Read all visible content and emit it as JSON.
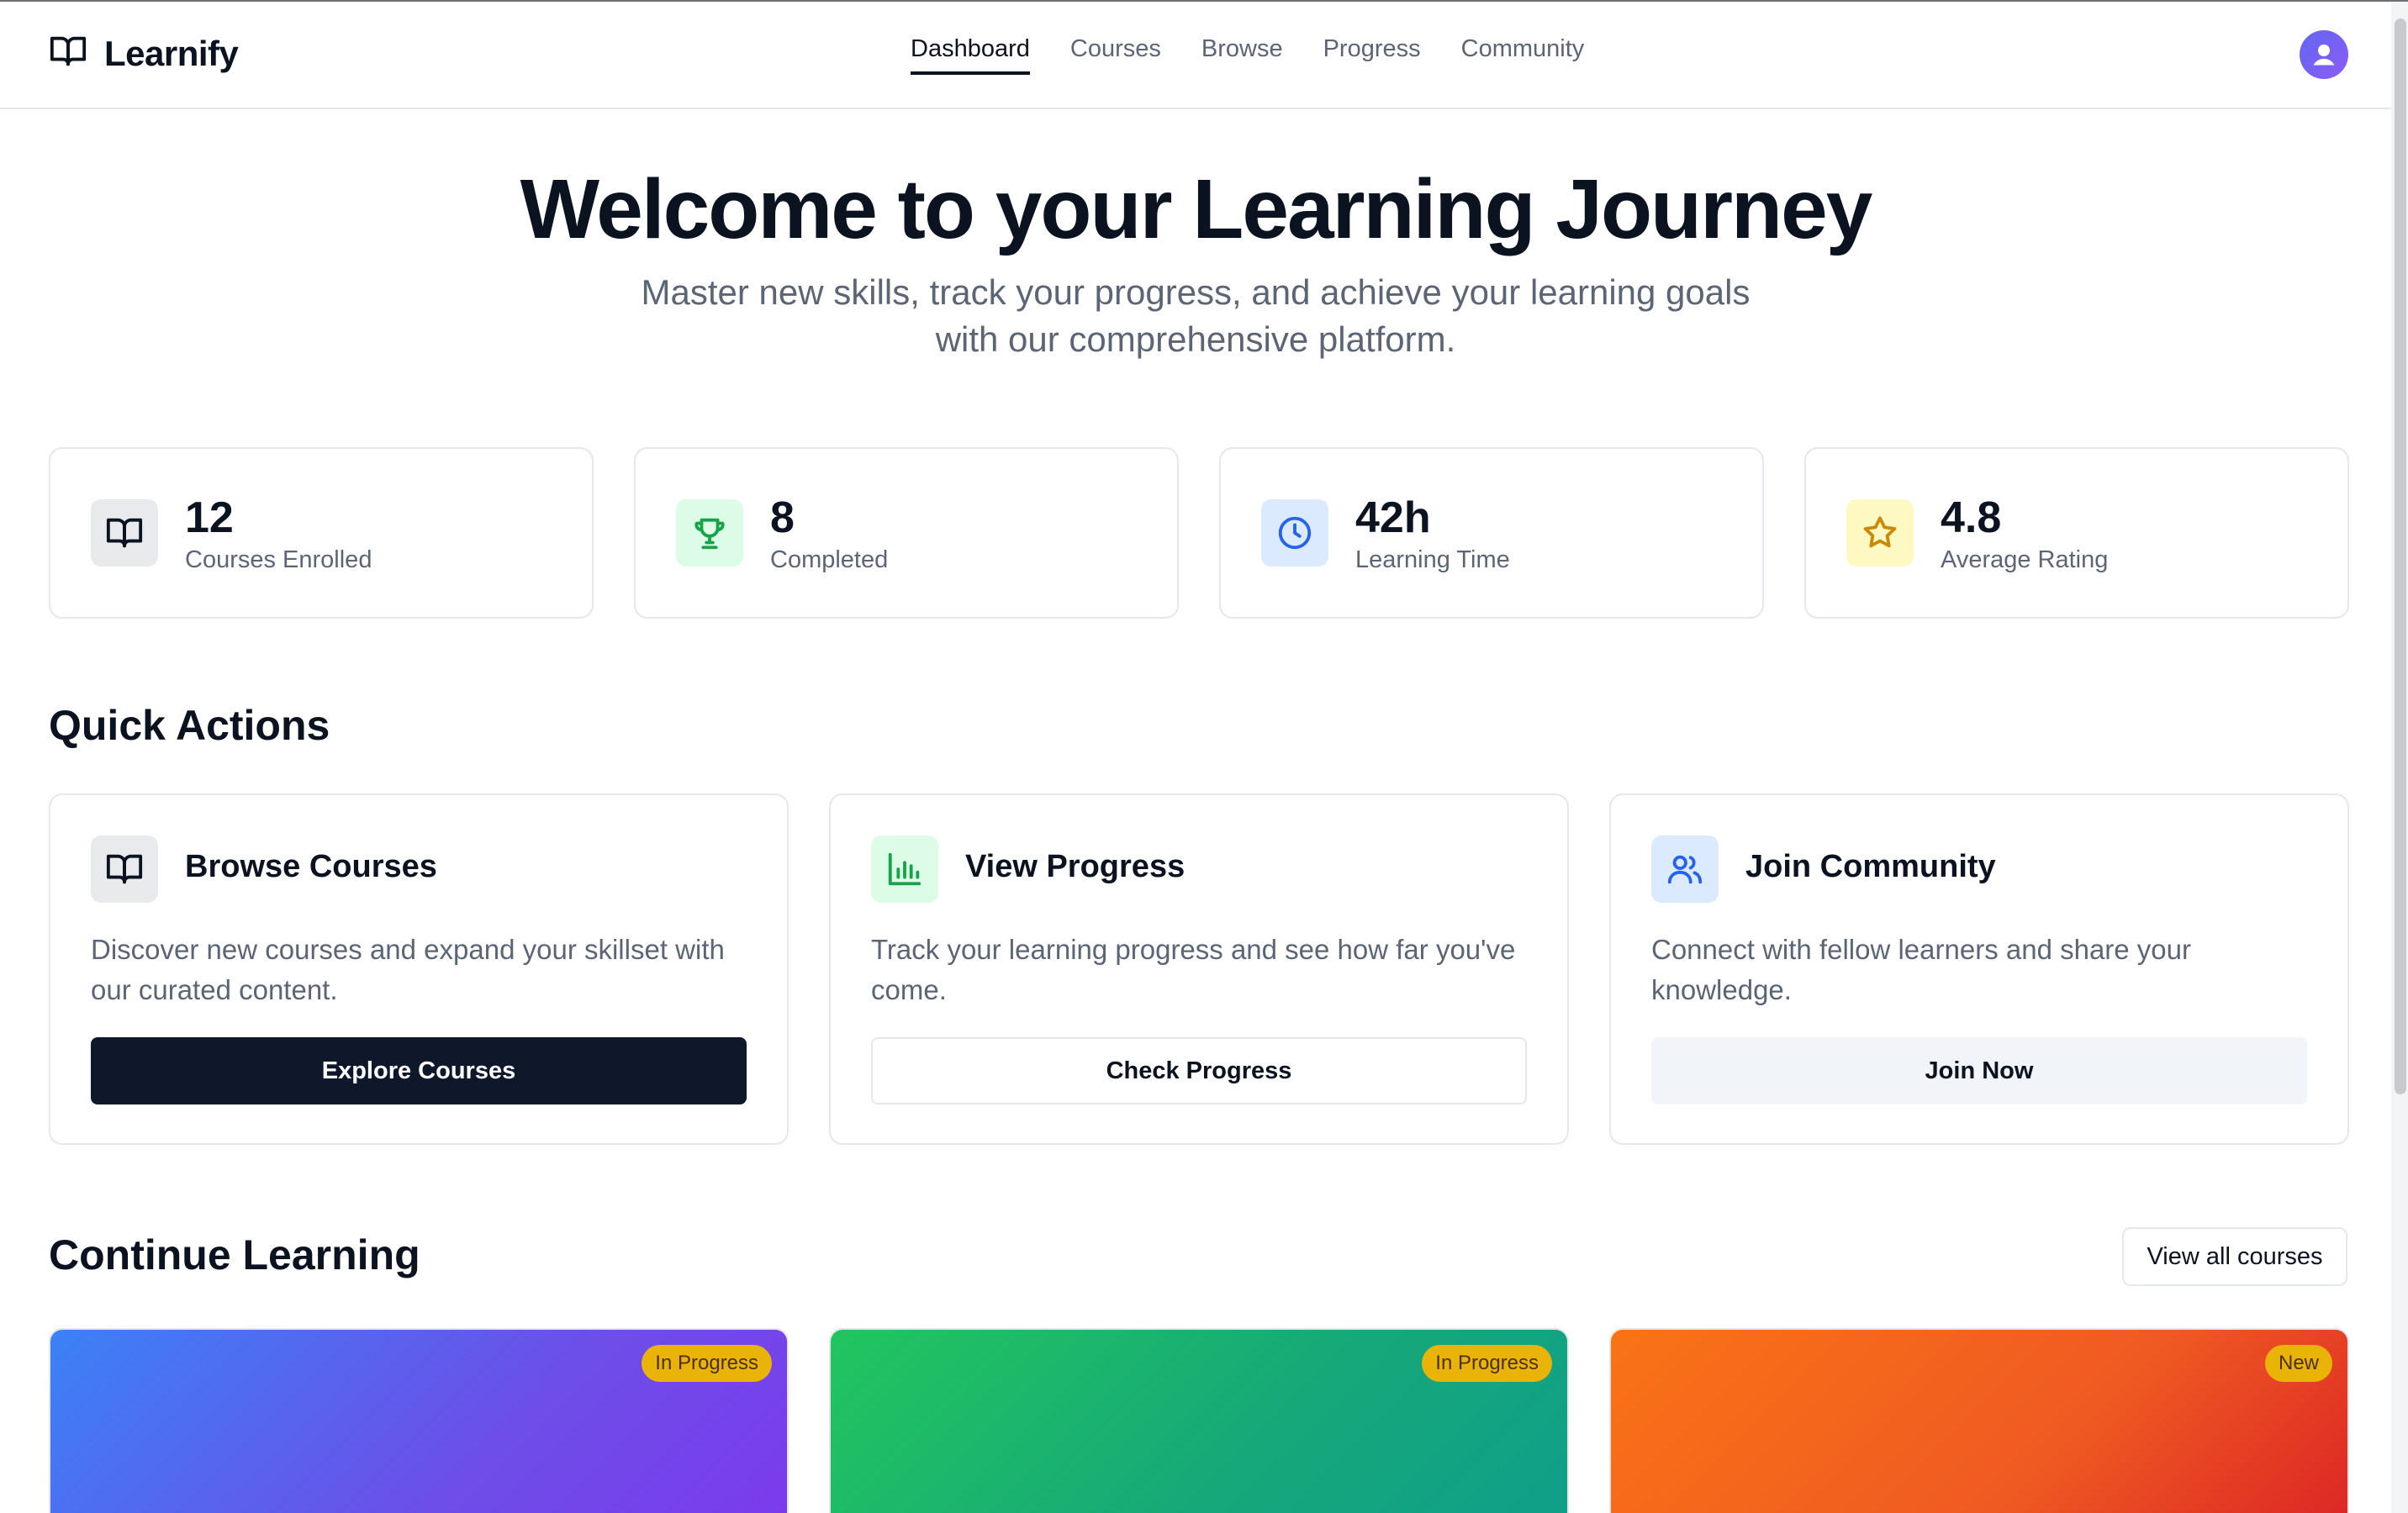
{
  "brand": {
    "name": "Learnify"
  },
  "nav": {
    "links": [
      {
        "label": "Dashboard",
        "active": true
      },
      {
        "label": "Courses",
        "active": false
      },
      {
        "label": "Browse",
        "active": false
      },
      {
        "label": "Progress",
        "active": false
      },
      {
        "label": "Community",
        "active": false
      }
    ]
  },
  "hero": {
    "title": "Welcome to your Learning Journey",
    "subtitle": "Master new skills, track your progress, and achieve your learning goals with our comprehensive platform."
  },
  "stats": [
    {
      "value": "12",
      "label": "Courses Enrolled",
      "icon": "book-icon",
      "color": "#0b1220",
      "bg": "#e9eaec"
    },
    {
      "value": "8",
      "label": "Completed",
      "icon": "trophy-icon",
      "color": "#16a34a",
      "bg": "#dcfce7"
    },
    {
      "value": "42h",
      "label": "Learning Time",
      "icon": "clock-icon",
      "color": "#2563eb",
      "bg": "#dbeafe"
    },
    {
      "value": "4.8",
      "label": "Average Rating",
      "icon": "star-icon",
      "color": "#ca8a04",
      "bg": "#fef9c3"
    }
  ],
  "quick_actions": {
    "title": "Quick Actions",
    "items": [
      {
        "title": "Browse Courses",
        "description": "Discover new courses and expand your skillset with our curated content.",
        "button": "Explore Courses",
        "icon": "book-icon"
      },
      {
        "title": "View Progress",
        "description": "Track your learning progress and see how far you've come.",
        "button": "Check Progress",
        "icon": "bar-chart-icon"
      },
      {
        "title": "Join Community",
        "description": "Connect with fellow learners and share your knowledge.",
        "button": "Join Now",
        "icon": "users-icon"
      }
    ]
  },
  "continue_learning": {
    "title": "Continue Learning",
    "view_all": "View all courses",
    "courses": [
      {
        "badge": "In Progress"
      },
      {
        "badge": "In Progress"
      },
      {
        "badge": "New"
      }
    ]
  }
}
